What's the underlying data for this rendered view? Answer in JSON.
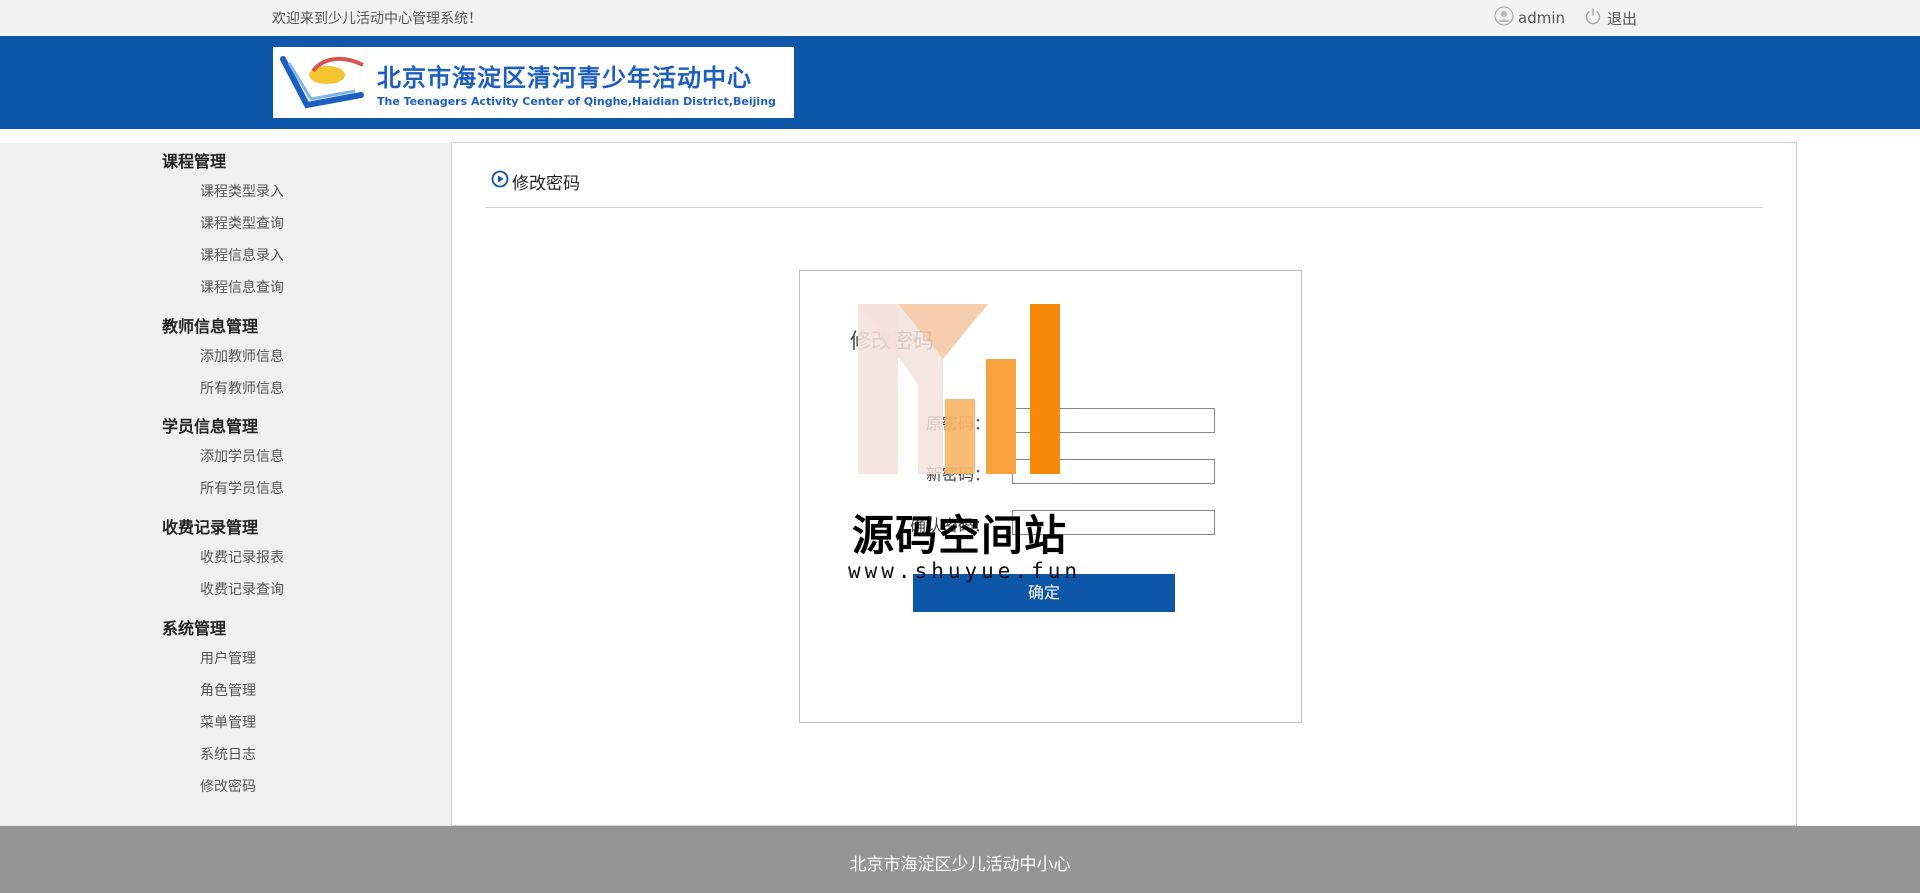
{
  "topbar": {
    "welcome": "欢迎来到少儿活动中心管理系统！",
    "user": "admin",
    "logout": "退出"
  },
  "header": {
    "logo_cn": "北京市海淀区清河青少年活动中心",
    "logo_en": "The Teenagers Activity Center of Qinghe,Haidian District,Beijing",
    "bg_color": "#0d56a8"
  },
  "sidebar": {
    "groups": [
      {
        "title": "课程管理",
        "items": [
          "课程类型录入",
          "课程类型查询",
          "课程信息录入",
          "课程信息查询"
        ]
      },
      {
        "title": "教师信息管理",
        "items": [
          "添加教师信息",
          "所有教师信息"
        ]
      },
      {
        "title": "学员信息管理",
        "items": [
          "添加学员信息",
          "所有学员信息"
        ]
      },
      {
        "title": "收费记录管理",
        "items": [
          "收费记录报表",
          "收费记录查询"
        ]
      },
      {
        "title": "系统管理",
        "items": [
          "用户管理",
          "角色管理",
          "菜单管理",
          "系统日志",
          "修改密码"
        ]
      }
    ]
  },
  "main": {
    "breadcrumb": "修改密码",
    "form": {
      "title": "修改密码",
      "old_password_label": "原密码：",
      "new_password_label": "新密码：",
      "confirm_password_label": "确认密码：",
      "submit_label": "确定"
    }
  },
  "watermark": {
    "cn": "源码空间站",
    "url": "www.shuyue.fun"
  },
  "footer": {
    "text": "北京市海淀区少儿活动中小心"
  }
}
